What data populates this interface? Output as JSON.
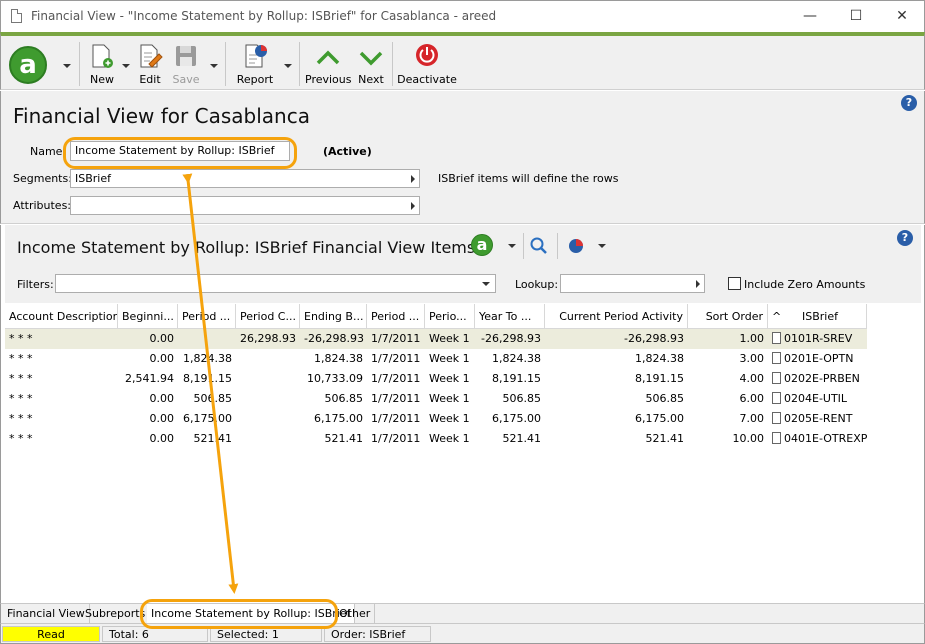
{
  "window": {
    "title": "Financial View - \"Income Statement by Rollup: ISBrief\" for Casablanca - areed",
    "min_glyph": "—",
    "max_glyph": "☐",
    "close_glyph": "✕"
  },
  "toolbar": {
    "logo_letter": "a",
    "new_label": "New",
    "edit_label": "Edit",
    "save_label": "Save",
    "report_label": "Report",
    "previous_label": "Previous",
    "next_label": "Next",
    "deactivate_label": "Deactivate"
  },
  "header": {
    "page_title": "Financial View for Casablanca",
    "help_glyph": "?",
    "name_label": "Name",
    "name_value": "Income Statement by Rollup: ISBrief",
    "status": "(Active)",
    "segments_label": "Segments:",
    "segments_value": "ISBrief",
    "segments_note": "ISBrief items will define the rows",
    "attributes_label": "Attributes:",
    "attributes_value": ""
  },
  "items": {
    "title": "Income Statement by Rollup: ISBrief Financial View Items",
    "filters_label": "Filters:",
    "lookup_label": "Lookup:",
    "include_zero_label": "Include Zero Amounts",
    "include_zero_checked": false
  },
  "grid": {
    "columns": [
      "Account Description",
      "Beginni...",
      "Period ...",
      "Period C...",
      "Ending B...",
      "Period ...",
      "Perio...",
      "Year To ...",
      "Current Period Activity",
      "Sort Order",
      "ISBrief"
    ],
    "sort_glyph": "^",
    "rows": [
      [
        "* * *",
        "0.00",
        "",
        "26,298.93",
        "-26,298.93",
        "1/7/2011",
        "Week 1",
        "-26,298.93",
        "-26,298.93",
        "1.00",
        "0101R-SREV"
      ],
      [
        "* * *",
        "0.00",
        "1,824.38",
        "",
        "1,824.38",
        "1/7/2011",
        "Week 1",
        "1,824.38",
        "1,824.38",
        "3.00",
        "0201E-OPTN"
      ],
      [
        "* * *",
        "2,541.94",
        "8,191.15",
        "",
        "10,733.09",
        "1/7/2011",
        "Week 1",
        "8,191.15",
        "8,191.15",
        "4.00",
        "0202E-PRBEN"
      ],
      [
        "* * *",
        "0.00",
        "506.85",
        "",
        "506.85",
        "1/7/2011",
        "Week 1",
        "506.85",
        "506.85",
        "6.00",
        "0204E-UTIL"
      ],
      [
        "* * *",
        "0.00",
        "6,175.00",
        "",
        "6,175.00",
        "1/7/2011",
        "Week 1",
        "6,175.00",
        "6,175.00",
        "7.00",
        "0205E-RENT"
      ],
      [
        "* * *",
        "0.00",
        "521.41",
        "",
        "521.41",
        "1/7/2011",
        "Week 1",
        "521.41",
        "521.41",
        "10.00",
        "0401E-OTREXP"
      ]
    ]
  },
  "tabs": [
    "Financial View",
    "Subreports",
    "Income Statement by Rollup: ISBrief",
    "Other"
  ],
  "status": {
    "mode": "Read",
    "total": "Total: 6",
    "selected": "Selected: 1",
    "order": "Order: ISBrief"
  },
  "colors": {
    "accent_green": "#7aa542",
    "highlight_orange": "#f5a30d",
    "status_read_bg": "#ffff00",
    "selected_row": "#ececdc"
  }
}
